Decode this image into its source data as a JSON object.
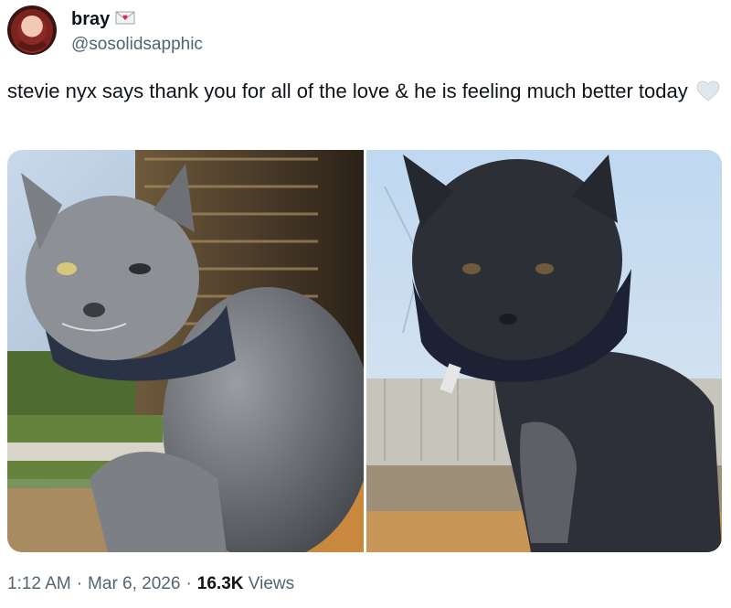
{
  "tweet": {
    "author": {
      "display_name": "bray",
      "handle": "@sosolidsapphic",
      "name_badge_icon": "love-letter-icon"
    },
    "text": "stevie nyx says thank you for all of the love & he is feeling much better today",
    "text_emoji_icon": "white-heart-icon",
    "media": [
      {
        "alt": "gray cat with cone collar sitting by window"
      },
      {
        "alt": "gray cat with cone collar backlit by window"
      }
    ],
    "meta": {
      "time": "1:12 AM",
      "separator": "·",
      "date": "Mar 6, 2026",
      "views_count": "16.3K",
      "views_label": "Views"
    }
  },
  "colors": {
    "text_primary": "#0f1419",
    "text_secondary": "#536471",
    "background": "#ffffff"
  }
}
